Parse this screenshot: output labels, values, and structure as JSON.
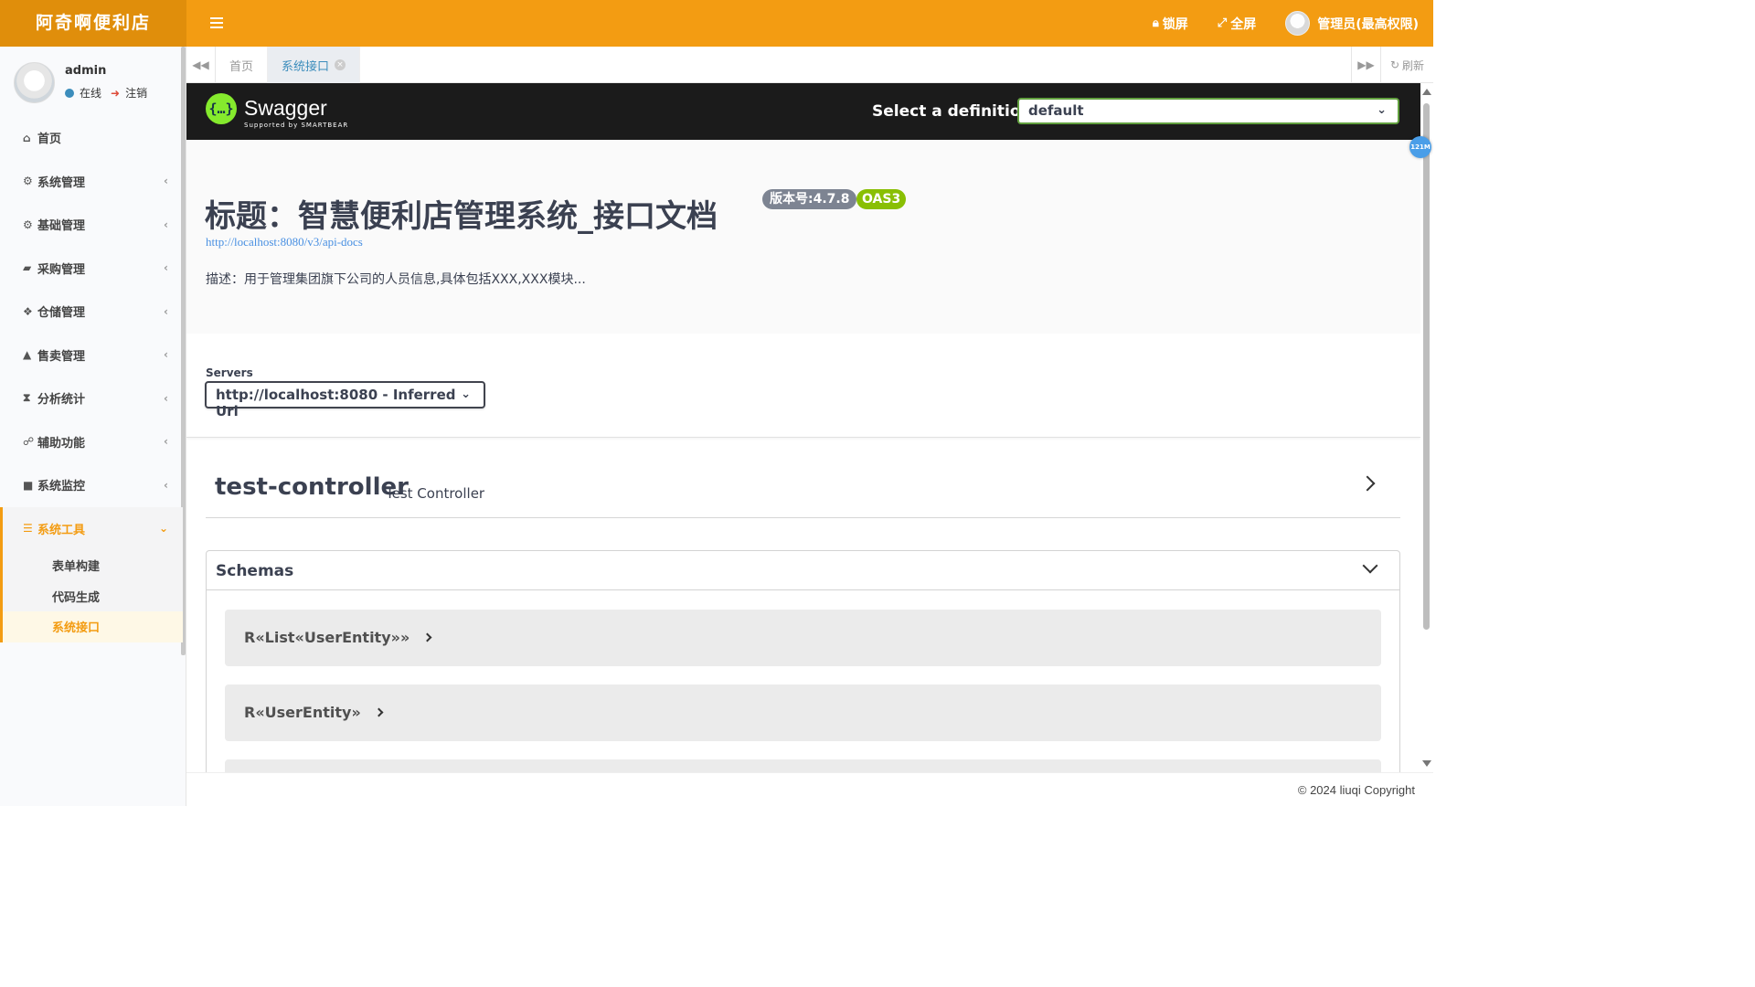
{
  "app": {
    "logo": "阿奇啊便利店",
    "lock_label": "锁屏",
    "fullscreen_label": "全屏",
    "user_label": "管理员(最高权限)"
  },
  "sidebar": {
    "user_name": "admin",
    "status_online": "在线",
    "logout_label": "注销",
    "items": [
      {
        "label": "首页",
        "icon": "home-icon"
      },
      {
        "label": "系统管理",
        "icon": "gear-icon"
      },
      {
        "label": "基础管理",
        "icon": "gears-icon"
      },
      {
        "label": "采购管理",
        "icon": "truck-icon"
      },
      {
        "label": "仓储管理",
        "icon": "cubes-icon"
      },
      {
        "label": "售卖管理",
        "icon": "shopping-bag-icon"
      },
      {
        "label": "分析统计",
        "icon": "hourglass-icon"
      },
      {
        "label": "辅助功能",
        "icon": "handshake-icon"
      },
      {
        "label": "系统监控",
        "icon": "video-camera-icon"
      },
      {
        "label": "系统工具",
        "icon": "list-icon"
      }
    ],
    "subitems": [
      "表单构建",
      "代码生成",
      "系统接口"
    ]
  },
  "tabs": {
    "home": "首页",
    "current": "系统接口",
    "refresh": "刷新"
  },
  "swagger": {
    "logo_text": "Swagger",
    "logo_sub": "Supported by SMARTBEAR",
    "select_label": "Select a definition",
    "definition": "default",
    "title": "标题：智慧便利店管理系统_接口文档",
    "version": "版本号:4.7.8",
    "oas": "OAS3",
    "api_docs_url": "http://localhost:8080/v3/api-docs",
    "description": "描述：用于管理集团旗下公司的人员信息,具体包括XXX,XXX模块...",
    "servers_label": "Servers",
    "server": "http://localhost:8080 - Inferred Url",
    "tag_name": "test-controller",
    "tag_desc": "Test Controller",
    "schemas_title": "Schemas",
    "models": [
      "R«List«UserEntity»»",
      "R«UserEntity»"
    ]
  },
  "memory_badge": "121M",
  "footer": "© 2024 liuqi Copyright",
  "colors": {
    "accent": "#f39c12",
    "logo_bg": "#e08e0b",
    "swagger_green": "#85ea2d",
    "oas_green": "#89bf04",
    "link": "#4990e2"
  }
}
